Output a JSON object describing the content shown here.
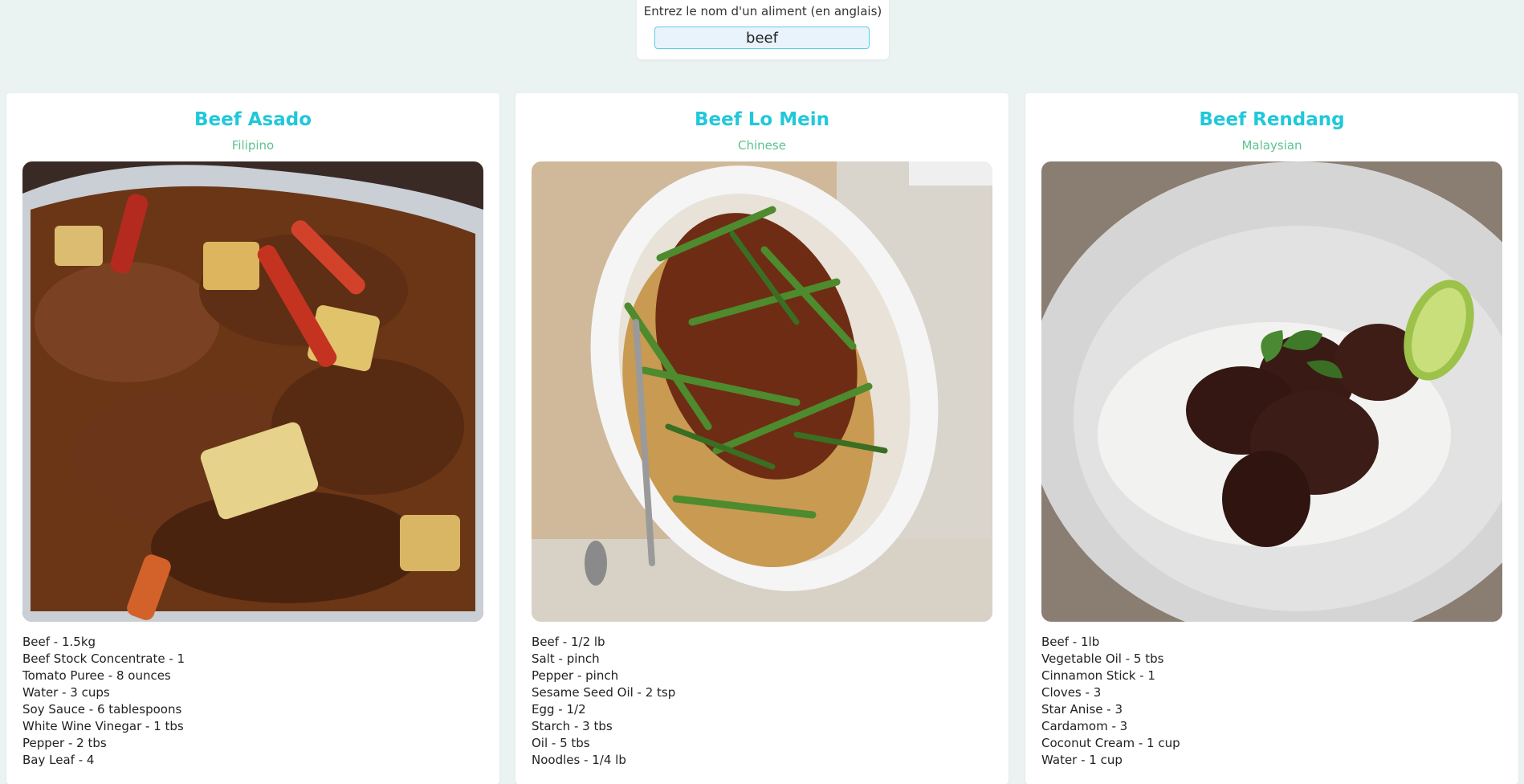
{
  "search": {
    "label": "Entrez le nom d'un aliment (en anglais)",
    "value": "beef"
  },
  "colors": {
    "page_background": "#eaf2f2",
    "title": "#20c8da",
    "cuisine": "#5cc48e",
    "input_border": "#5dcfe0"
  },
  "recipes": [
    {
      "title": "Beef Asado",
      "cuisine": "Filipino",
      "ingredients": [
        "Beef - 1.5kg",
        "Beef Stock Concentrate - 1",
        "Tomato Puree - 8 ounces",
        "Water - 3 cups",
        "Soy Sauce - 6 tablespoons",
        "White Wine Vinegar - 1 tbs",
        "Pepper - 2 tbs",
        "Bay Leaf - 4"
      ]
    },
    {
      "title": "Beef Lo Mein",
      "cuisine": "Chinese",
      "ingredients": [
        "Beef - 1/2 lb",
        "Salt - pinch",
        "Pepper - pinch",
        "Sesame Seed Oil - 2 tsp",
        "Egg - 1/2",
        "Starch - 3 tbs",
        "Oil - 5 tbs",
        "Noodles - 1/4 lb"
      ]
    },
    {
      "title": "Beef Rendang",
      "cuisine": "Malaysian",
      "ingredients": [
        "Beef - 1lb",
        "Vegetable Oil - 5 tbs",
        "Cinnamon Stick - 1",
        "Cloves - 3",
        "Star Anise - 3",
        "Cardamom - 3",
        "Coconut Cream - 1 cup",
        "Water - 1 cup"
      ]
    }
  ]
}
